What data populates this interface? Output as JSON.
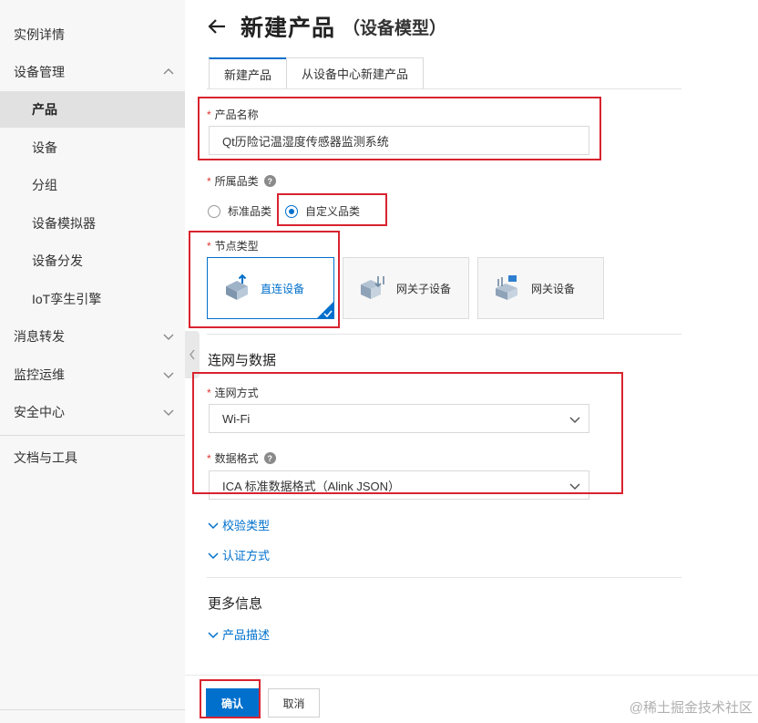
{
  "sidebar": {
    "items": [
      {
        "label": "实例详情"
      },
      {
        "label": "设备管理"
      },
      {
        "label": "产品"
      },
      {
        "label": "设备"
      },
      {
        "label": "分组"
      },
      {
        "label": "设备模拟器"
      },
      {
        "label": "设备分发"
      },
      {
        "label": "IoT孪生引擎"
      },
      {
        "label": "消息转发"
      },
      {
        "label": "监控运维"
      },
      {
        "label": "安全中心"
      },
      {
        "label": "文档与工具"
      }
    ]
  },
  "header": {
    "title": "新建产品",
    "subtitle": "（设备模型）"
  },
  "tabs": [
    {
      "label": "新建产品"
    },
    {
      "label": "从设备中心新建产品"
    }
  ],
  "form": {
    "product_name": {
      "label": "产品名称",
      "value": "Qt历险记温湿度传感器监测系统"
    },
    "category": {
      "label": "所属品类",
      "options": [
        {
          "label": "标准品类"
        },
        {
          "label": "自定义品类"
        }
      ],
      "selected": "自定义品类"
    },
    "node_type": {
      "label": "节点类型",
      "options": [
        {
          "label": "直连设备"
        },
        {
          "label": "网关子设备"
        },
        {
          "label": "网关设备"
        }
      ],
      "selected": "直连设备"
    },
    "network_section_title": "连网与数据",
    "network_method": {
      "label": "连网方式",
      "value": "Wi-Fi"
    },
    "data_format": {
      "label": "数据格式",
      "value": "ICA 标准数据格式（Alink JSON）"
    },
    "verify_type": "校验类型",
    "auth_method": "认证方式",
    "more_section_title": "更多信息",
    "product_desc": "产品描述"
  },
  "footer": {
    "confirm_label": "确认",
    "cancel_label": "取消"
  },
  "watermark": "@稀土掘金技术社区",
  "colors": {
    "primary": "#0070cc",
    "highlight": "#d9232f",
    "required": "#e03434"
  }
}
